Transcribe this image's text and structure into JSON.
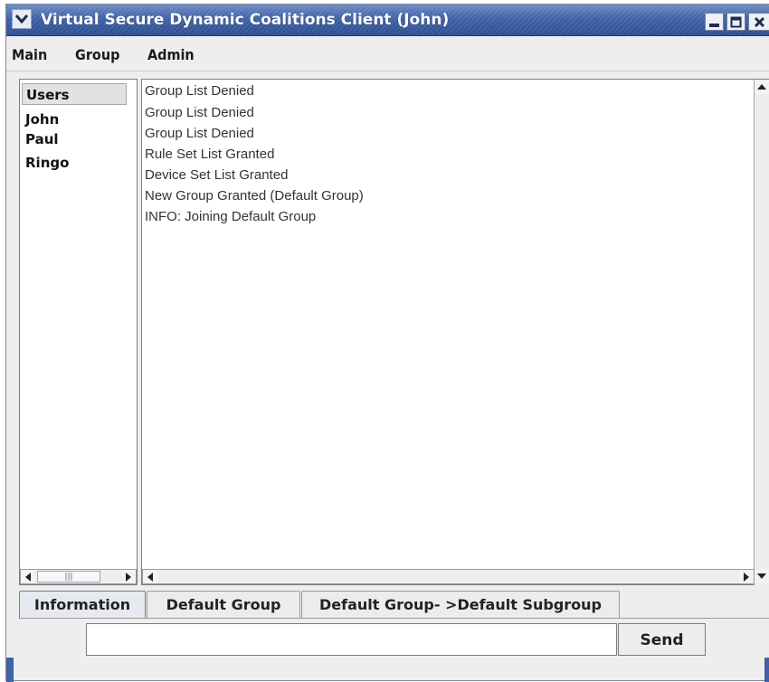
{
  "window": {
    "title": "Virtual Secure Dynamic Coalitions Client (John)",
    "buttons": [
      "minimize-icon",
      "maximize-icon",
      "close-icon"
    ],
    "title_bar_color": "#3f62a8"
  },
  "menubar": {
    "items": [
      {
        "label": "Main"
      },
      {
        "label": "Group"
      },
      {
        "label": "Admin"
      }
    ]
  },
  "users": {
    "header": "Users",
    "items": [
      "John",
      "Paul",
      "Ringo"
    ]
  },
  "messages": {
    "lines": [
      "Group List Denied",
      "Group List Denied",
      "Group List Denied",
      "Rule Set List Granted",
      "Device Set List Granted",
      "New Group Granted (Default Group)",
      "INFO: Joining Default Group"
    ]
  },
  "tabs": [
    {
      "label": "Information",
      "selected": true
    },
    {
      "label": "Default Group",
      "selected": false
    },
    {
      "label": "Default Group- >Default Subgroup",
      "selected": false
    }
  ],
  "input": {
    "value": "",
    "send_label": "Send"
  }
}
